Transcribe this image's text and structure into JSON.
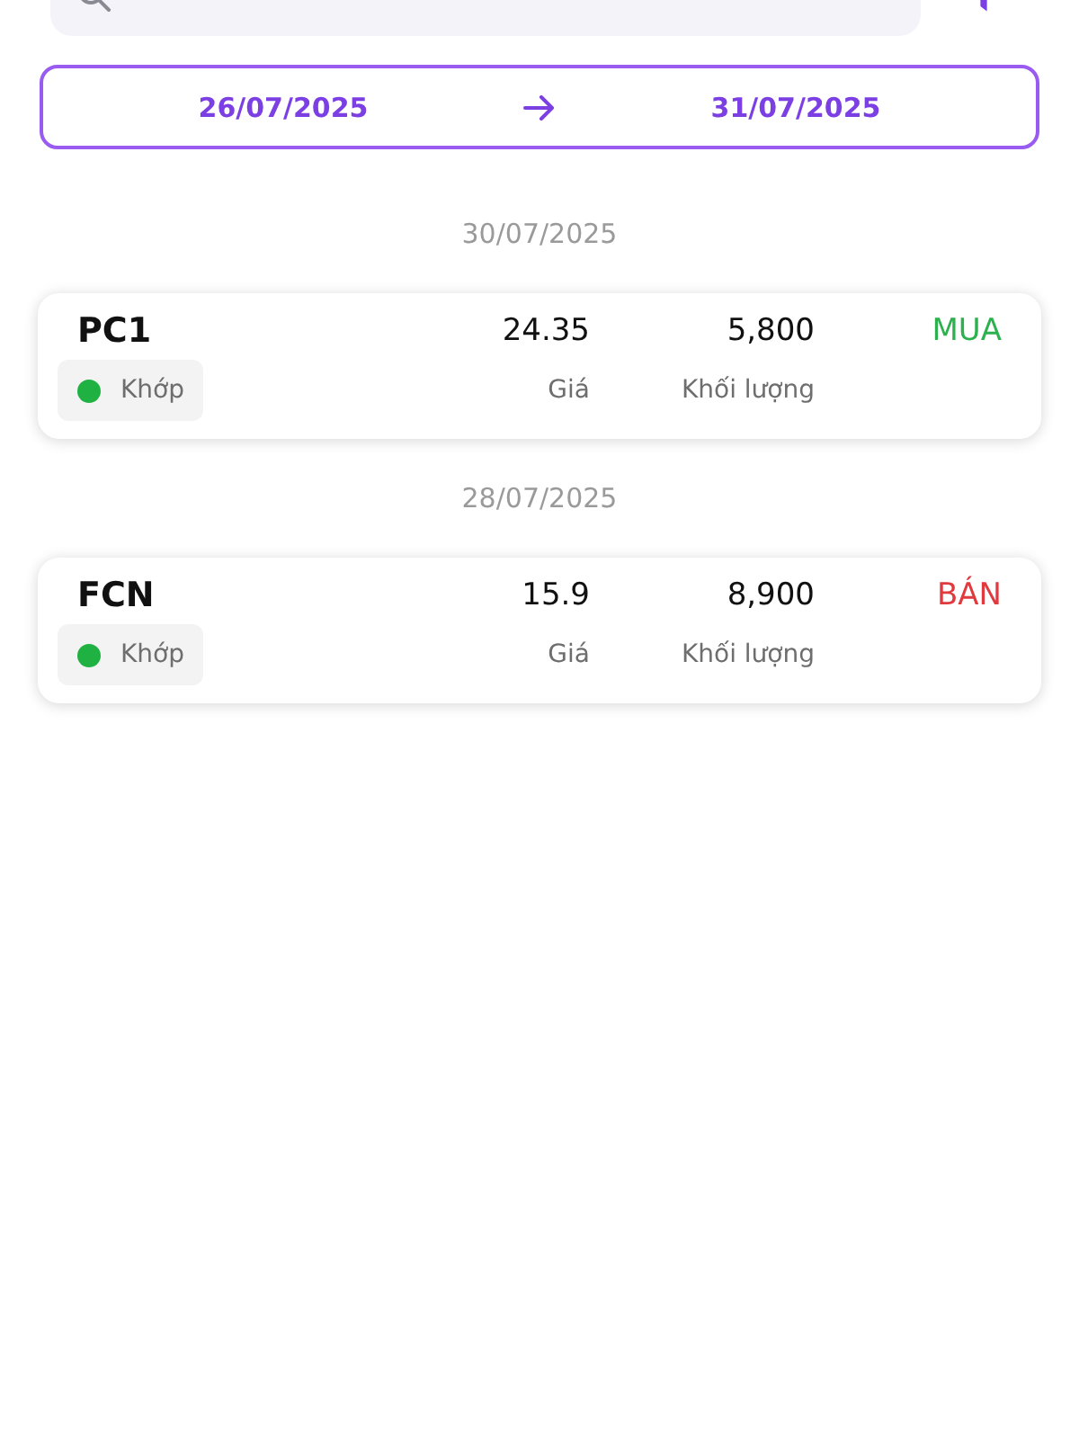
{
  "date_range": {
    "from": "26/07/2025",
    "to": "31/07/2025"
  },
  "groups": [
    {
      "date": "30/07/2025",
      "orders": [
        {
          "symbol": "PC1",
          "price": "24.35",
          "volume": "5,800",
          "price_label": "Giá",
          "volume_label": "Khối lượng",
          "side": {
            "label": "MUA",
            "color": "#2db14f"
          },
          "status": {
            "label": "Khớp",
            "color": "#1fb141"
          }
        }
      ]
    },
    {
      "date": "28/07/2025",
      "orders": [
        {
          "symbol": "FCN",
          "price": "15.9",
          "volume": "8,900",
          "price_label": "Giá",
          "volume_label": "Khối lượng",
          "side": {
            "label": "BÁN",
            "color": "#e0393e"
          },
          "status": {
            "label": "Khớp",
            "color": "#1fb141"
          }
        }
      ]
    }
  ]
}
